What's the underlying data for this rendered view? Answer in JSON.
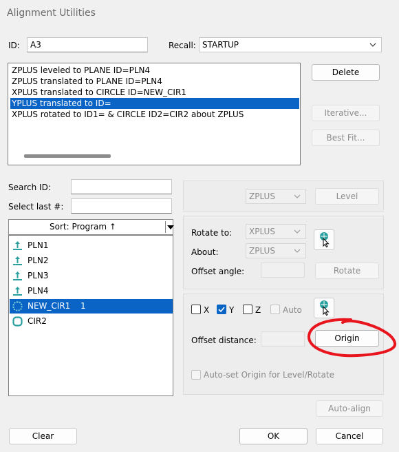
{
  "window": {
    "title": "Alignment Utilities"
  },
  "id_field": {
    "label": "ID:",
    "value": "A3"
  },
  "recall": {
    "label": "Recall:",
    "value": "STARTUP"
  },
  "alignment_list": [
    {
      "text": "ZPLUS leveled to PLANE ID=PLN4",
      "selected": false
    },
    {
      "text": "ZPLUS translated to PLANE ID=PLN4",
      "selected": false
    },
    {
      "text": "XPLUS translated to CIRCLE ID=NEW_CIR1",
      "selected": false
    },
    {
      "text": "YPLUS translated to  ID=",
      "selected": true
    },
    {
      "text": "XPLUS rotated to  ID1= & CIRCLE ID2=CIR2 about ZPLUS",
      "selected": false
    }
  ],
  "buttons": {
    "delete": "Delete",
    "iterative": "Iterative...",
    "best_fit": "Best Fit...",
    "level": "Level",
    "rotate": "Rotate",
    "origin": "Origin",
    "auto_align": "Auto-align",
    "clear": "Clear",
    "ok": "OK",
    "cancel": "Cancel"
  },
  "search": {
    "label": "Search ID:",
    "value": ""
  },
  "select_last": {
    "label": "Select last #:",
    "value": ""
  },
  "sort": {
    "label": "Sort: Program ↑"
  },
  "features": [
    {
      "name": "PLN1",
      "type": "plane",
      "count": "",
      "selected": false
    },
    {
      "name": "PLN2",
      "type": "plane",
      "count": "",
      "selected": false
    },
    {
      "name": "PLN3",
      "type": "plane",
      "count": "",
      "selected": false
    },
    {
      "name": "PLN4",
      "type": "plane",
      "count": "",
      "selected": false
    },
    {
      "name": "NEW_CIR1",
      "type": "circle",
      "count": "1",
      "selected": true
    },
    {
      "name": "CIR2",
      "type": "circle",
      "count": "",
      "selected": false
    }
  ],
  "level_group": {
    "axis": "ZPLUS"
  },
  "rotate_group": {
    "rotate_to_label": "Rotate to:",
    "rotate_to": "XPLUS",
    "about_label": "About:",
    "about": "ZPLUS",
    "offset_angle_label": "Offset angle:",
    "offset_angle": ""
  },
  "origin_group": {
    "x_label": "X",
    "x_checked": false,
    "y_label": "Y",
    "y_checked": true,
    "z_label": "Z",
    "z_checked": false,
    "auto_label": "Auto",
    "auto_checked": false,
    "offset_distance_label": "Offset distance:",
    "offset_distance": "",
    "auto_set_label": "Auto-set Origin for Level/Rotate"
  },
  "colors": {
    "selection": "#0a64c6",
    "annotation_circle": "#e8141e",
    "feature_icon": "#2a9fa0"
  }
}
